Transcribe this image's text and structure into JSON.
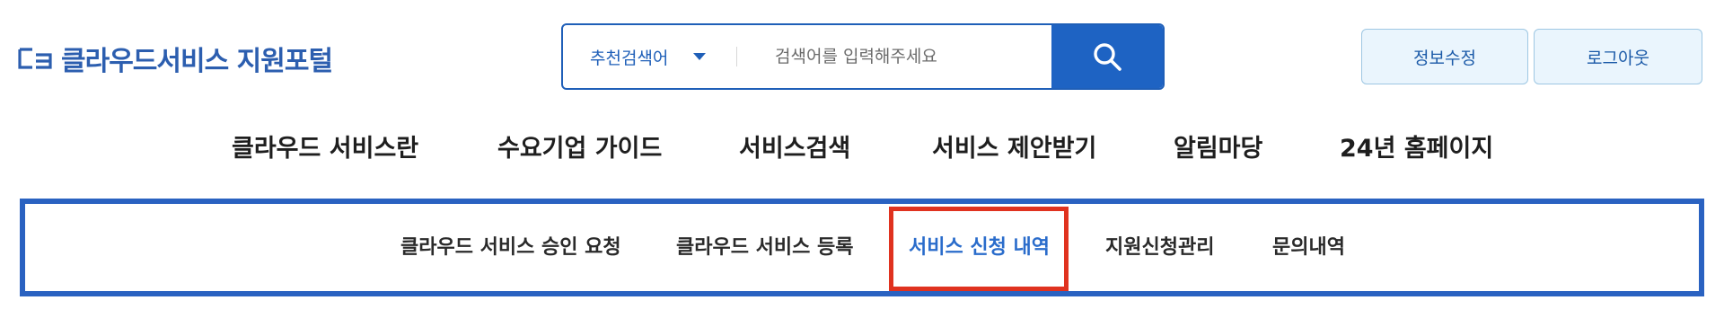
{
  "colors": {
    "brand": "#2c5eaf",
    "primary": "#1e63c3",
    "active_tab": "#2a6ccb",
    "highlight": "#e0321f"
  },
  "logo": {
    "text": "클라우드서비스 지원포털",
    "icon": "cloud-service-logo-mark"
  },
  "search": {
    "category_selected": "추천검색어",
    "placeholder": "검색어를 입력해주세요",
    "button_icon": "search-icon"
  },
  "header_buttons": {
    "edit_info": "정보수정",
    "logout": "로그아웃"
  },
  "gnb": {
    "items": [
      {
        "label": "클라우드 서비스란"
      },
      {
        "label": "수요기업 가이드"
      },
      {
        "label": "서비스검색"
      },
      {
        "label": "서비스 제안받기"
      },
      {
        "label": "알림마당"
      },
      {
        "label": "24년 홈페이지"
      }
    ]
  },
  "subnav": {
    "items": [
      {
        "label": "클라우드 서비스 승인 요청"
      },
      {
        "label": "클라우드 서비스 등록"
      },
      {
        "label": "서비스 신청 내역",
        "active": true
      },
      {
        "label": "지원신청관리"
      },
      {
        "label": "문의내역"
      }
    ]
  }
}
